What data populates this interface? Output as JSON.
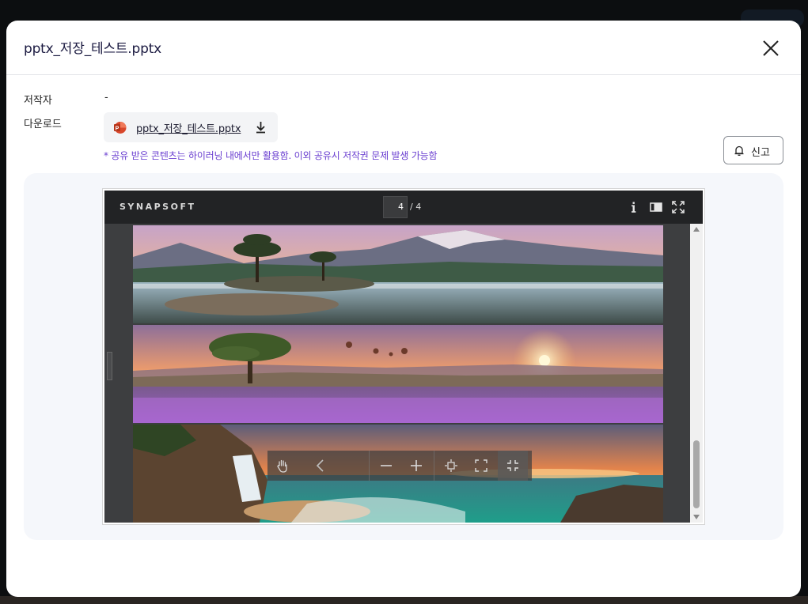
{
  "modal": {
    "title": "pptx_저장_테스트.pptx"
  },
  "meta": {
    "author_label": "저작자",
    "author_value": "-",
    "download_label": "다운로드",
    "file_name": "pptx_저장_테스트.pptx"
  },
  "notice": "* 공유 받은 콘텐츠는 하이러닝 내에서만 활용함. 이외 공유시 저작권 문제 발생 가능함",
  "report_button": {
    "label": "신고"
  },
  "viewer": {
    "brand": "SYNAPSOFT",
    "current_page": "4",
    "total_pages": "/ 4"
  },
  "colors": {
    "notice": "#6a3fd0",
    "title": "#1a1940",
    "viewer_toolbar": "#222325",
    "ppt_icon": "#d8472b"
  },
  "icons": {
    "close": "close-icon",
    "file_type": "powerpoint-icon",
    "download": "download-icon",
    "report": "bell-icon",
    "info": "info-icon",
    "sidebar": "sidebar-toggle-icon",
    "fullscreen": "fullscreen-icon",
    "pan": "hand-icon",
    "prev": "chevron-left-icon",
    "zoom_out": "minus-icon",
    "zoom_in": "plus-icon",
    "fit": "fit-page-icon",
    "expand": "expand-icon",
    "collapse": "collapse-icon"
  }
}
